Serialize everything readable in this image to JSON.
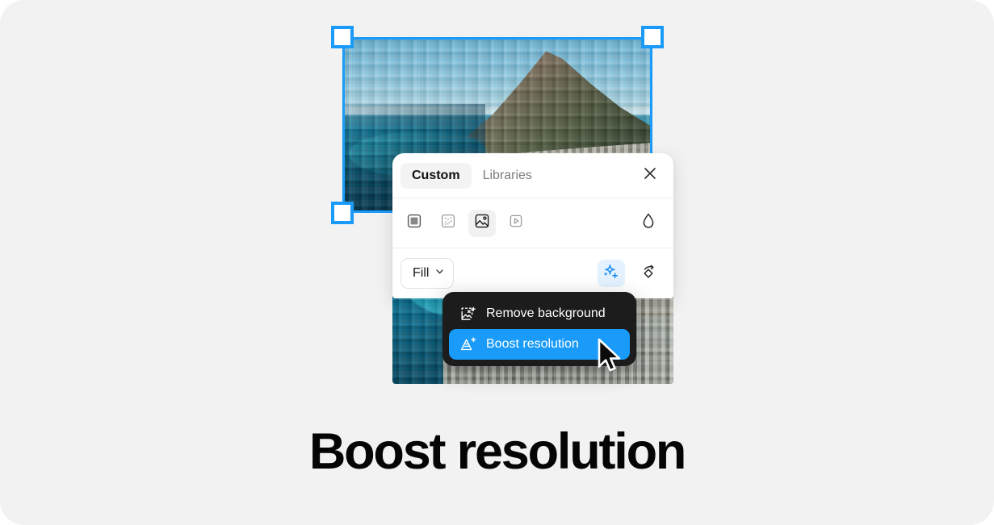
{
  "caption": "Boost resolution",
  "theme": {
    "background": "#f2f2f2",
    "accent_blue": "#1a9bfa",
    "menu_background": "#1c1c1c",
    "panel_background": "#ffffff"
  },
  "canvas": {
    "selection": {
      "name": "selected-image",
      "handles": [
        "top-left",
        "top-right",
        "bottom-left"
      ]
    }
  },
  "panel": {
    "tabs": [
      {
        "label": "Custom",
        "active": true
      },
      {
        "label": "Libraries",
        "active": false
      }
    ],
    "close_label": "close-icon",
    "type_tools": [
      {
        "name": "solid-fill-tool",
        "icon": "square-icon",
        "selected": false
      },
      {
        "name": "pattern-fill-tool",
        "icon": "dots-pattern-icon",
        "selected": false
      },
      {
        "name": "image-fill-tool",
        "icon": "image-icon",
        "selected": true
      },
      {
        "name": "video-fill-tool",
        "icon": "video-play-icon",
        "selected": false
      }
    ],
    "opacity_tool": {
      "name": "opacity-tool",
      "icon": "droplet-icon"
    },
    "fill_mode": {
      "label": "Fill",
      "chevron": "chevron-down-icon"
    },
    "ai_tool": {
      "name": "ai-effects-button",
      "icon": "sparkle-plus-icon",
      "active": true
    },
    "transform_tool": {
      "name": "flip-rotate-button",
      "icon": "rotate-diamond-icon"
    }
  },
  "context_menu": {
    "items": [
      {
        "label": "Remove background",
        "icon": "remove-background-icon",
        "highlighted": false
      },
      {
        "label": "Boost resolution",
        "icon": "boost-resolution-icon",
        "highlighted": true
      }
    ]
  },
  "cursor": {
    "name": "mouse-pointer"
  }
}
